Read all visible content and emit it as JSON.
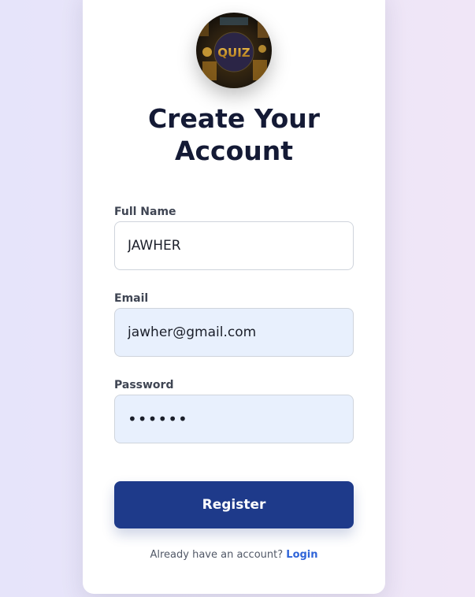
{
  "logo": {
    "text": "QUIZ",
    "icon": "quiz-logo-icon"
  },
  "title": {
    "line1": "Create Your",
    "line2": "Account"
  },
  "form": {
    "full_name": {
      "label": "Full Name",
      "value": "JAWHER"
    },
    "email": {
      "label": "Email",
      "value": "jawher@gmail.com"
    },
    "password": {
      "label": "Password",
      "value": "••••••"
    },
    "register_label": "Register"
  },
  "footer": {
    "prompt": "Already have an account?",
    "login_label": "Login"
  },
  "colors": {
    "primary": "#1e3a8a",
    "link": "#2f64d8",
    "autofill_bg": "#e8f0fd",
    "heading": "#141a35"
  }
}
